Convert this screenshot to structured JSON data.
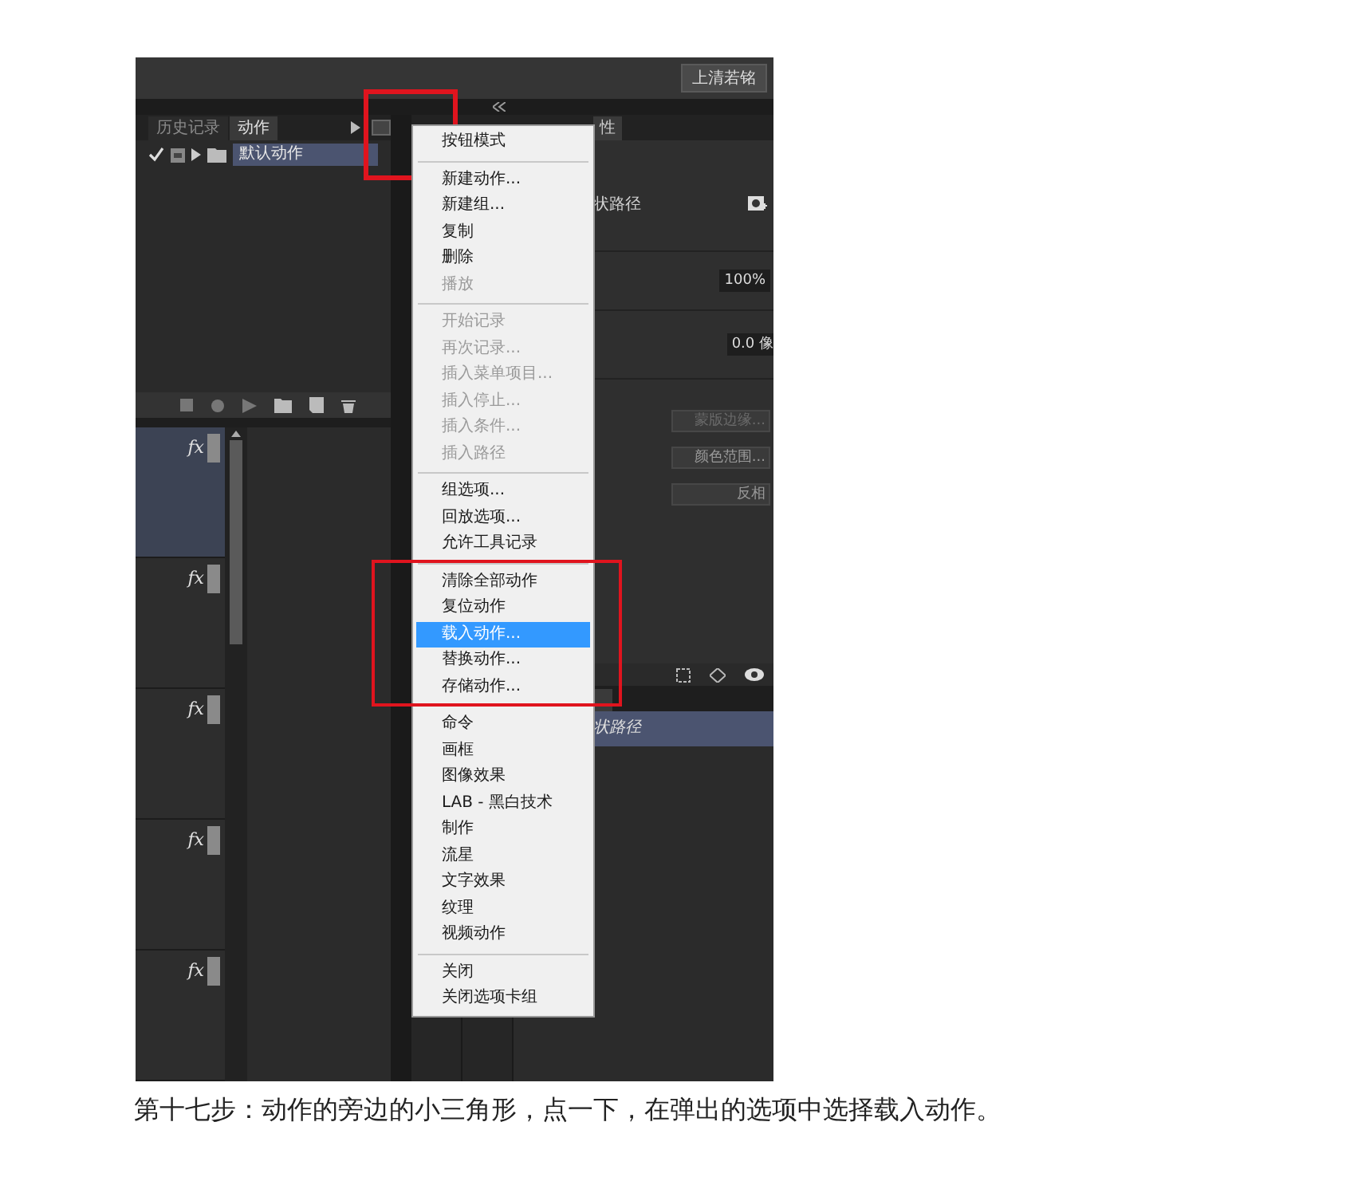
{
  "screenshot": {
    "top_button": "上清若铭",
    "actions_panel": {
      "tabs": [
        {
          "label": "历史记录",
          "selected": false
        },
        {
          "label": "动作",
          "selected": true
        }
      ],
      "rows": [
        {
          "name": "默认动作",
          "checked": true,
          "selected": true
        }
      ]
    },
    "layers": [
      {
        "badge": "fx",
        "selected": true
      },
      {
        "badge": "fx",
        "selected": false
      },
      {
        "badge": "fx",
        "selected": false
      },
      {
        "badge": "fx",
        "selected": false
      },
      {
        "badge": "fx",
        "selected": false
      }
    ],
    "properties": {
      "tab": "性",
      "path_label": "状路径",
      "field_1": "100%",
      "field_2": "0.0 像",
      "buttons": [
        {
          "label": "蒙版边缘...",
          "disabled": true
        },
        {
          "label": "颜色范围...",
          "disabled": false
        },
        {
          "label": "反相",
          "disabled": false
        }
      ]
    },
    "paths_panel": {
      "rows": [
        {
          "name": "状路径",
          "selected": true
        }
      ]
    },
    "menu": {
      "items": [
        {
          "kind": "item",
          "label": "按钮模式",
          "disabled": false,
          "selected": false
        },
        {
          "kind": "separator"
        },
        {
          "kind": "item",
          "label": "新建动作...",
          "disabled": false,
          "selected": false
        },
        {
          "kind": "item",
          "label": "新建组...",
          "disabled": false,
          "selected": false
        },
        {
          "kind": "item",
          "label": "复制",
          "disabled": false,
          "selected": false
        },
        {
          "kind": "item",
          "label": "删除",
          "disabled": false,
          "selected": false
        },
        {
          "kind": "item",
          "label": "播放",
          "disabled": true,
          "selected": false
        },
        {
          "kind": "separator"
        },
        {
          "kind": "item",
          "label": "开始记录",
          "disabled": true,
          "selected": false
        },
        {
          "kind": "item",
          "label": "再次记录...",
          "disabled": true,
          "selected": false
        },
        {
          "kind": "item",
          "label": "插入菜单项目...",
          "disabled": true,
          "selected": false
        },
        {
          "kind": "item",
          "label": "插入停止...",
          "disabled": true,
          "selected": false
        },
        {
          "kind": "item",
          "label": "插入条件...",
          "disabled": true,
          "selected": false
        },
        {
          "kind": "item",
          "label": "插入路径",
          "disabled": true,
          "selected": false
        },
        {
          "kind": "separator"
        },
        {
          "kind": "item",
          "label": "组选项...",
          "disabled": false,
          "selected": false
        },
        {
          "kind": "item",
          "label": "回放选项...",
          "disabled": false,
          "selected": false
        },
        {
          "kind": "item",
          "label": "允许工具记录",
          "disabled": false,
          "selected": false
        },
        {
          "kind": "separator"
        },
        {
          "kind": "item",
          "label": "清除全部动作",
          "disabled": false,
          "selected": false
        },
        {
          "kind": "item",
          "label": "复位动作",
          "disabled": false,
          "selected": false
        },
        {
          "kind": "item",
          "label": "载入动作...",
          "disabled": false,
          "selected": true
        },
        {
          "kind": "item",
          "label": "替换动作...",
          "disabled": false,
          "selected": false
        },
        {
          "kind": "item",
          "label": "存储动作...",
          "disabled": false,
          "selected": false
        },
        {
          "kind": "separator"
        },
        {
          "kind": "item",
          "label": "命令",
          "disabled": false,
          "selected": false
        },
        {
          "kind": "item",
          "label": "画框",
          "disabled": false,
          "selected": false
        },
        {
          "kind": "item",
          "label": "图像效果",
          "disabled": false,
          "selected": false
        },
        {
          "kind": "item",
          "label": "LAB - 黑白技术",
          "disabled": false,
          "selected": false
        },
        {
          "kind": "item",
          "label": "制作",
          "disabled": false,
          "selected": false
        },
        {
          "kind": "item",
          "label": "流星",
          "disabled": false,
          "selected": false
        },
        {
          "kind": "item",
          "label": "文字效果",
          "disabled": false,
          "selected": false
        },
        {
          "kind": "item",
          "label": "纹理",
          "disabled": false,
          "selected": false
        },
        {
          "kind": "item",
          "label": "视频动作",
          "disabled": false,
          "selected": false
        },
        {
          "kind": "separator"
        },
        {
          "kind": "item",
          "label": "关闭",
          "disabled": false,
          "selected": false
        },
        {
          "kind": "item",
          "label": "关闭选项卡组",
          "disabled": false,
          "selected": false
        }
      ]
    }
  },
  "caption": "第十七步：动作的旁边的小三角形，点一下，在弹出的选项中选择载入动作。"
}
